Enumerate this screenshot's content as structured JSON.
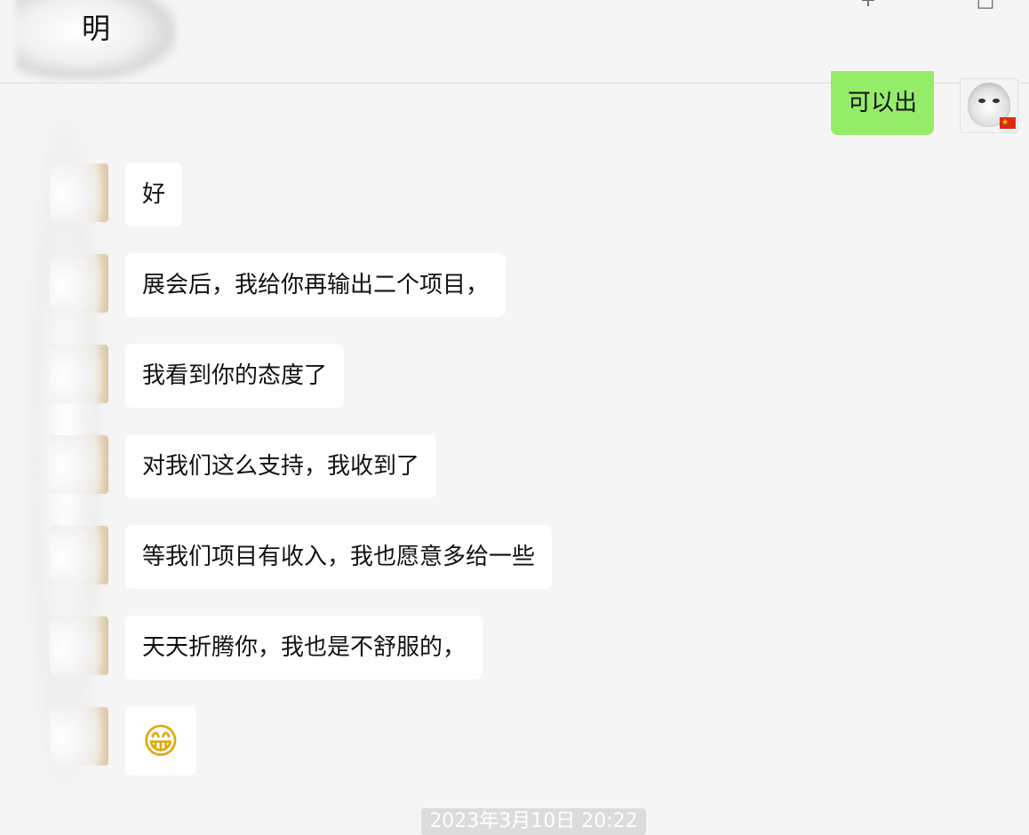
{
  "header": {
    "title": "明",
    "icons": [
      "add-icon",
      "more-icon"
    ]
  },
  "messages": [
    {
      "side": "right",
      "text": "可以出"
    },
    {
      "side": "left",
      "text": "好"
    },
    {
      "side": "left",
      "text": "展会后，我给你再输出二个项目，"
    },
    {
      "side": "left",
      "text": "我看到你的态度了"
    },
    {
      "side": "left",
      "text": "对我们这么支持，我收到了"
    },
    {
      "side": "left",
      "text": "等我们项目有收入，我也愿意多给一些"
    },
    {
      "side": "left",
      "text": "天天折腾你，我也是不舒服的，"
    },
    {
      "side": "left",
      "text": "😁",
      "emoji": "grinning-face-emoji"
    }
  ],
  "timestamp": "2023年3月10日 20:22",
  "colors": {
    "background": "#f5f5f5",
    "incoming_bubble": "#ffffff",
    "outgoing_bubble": "#95ec69"
  }
}
